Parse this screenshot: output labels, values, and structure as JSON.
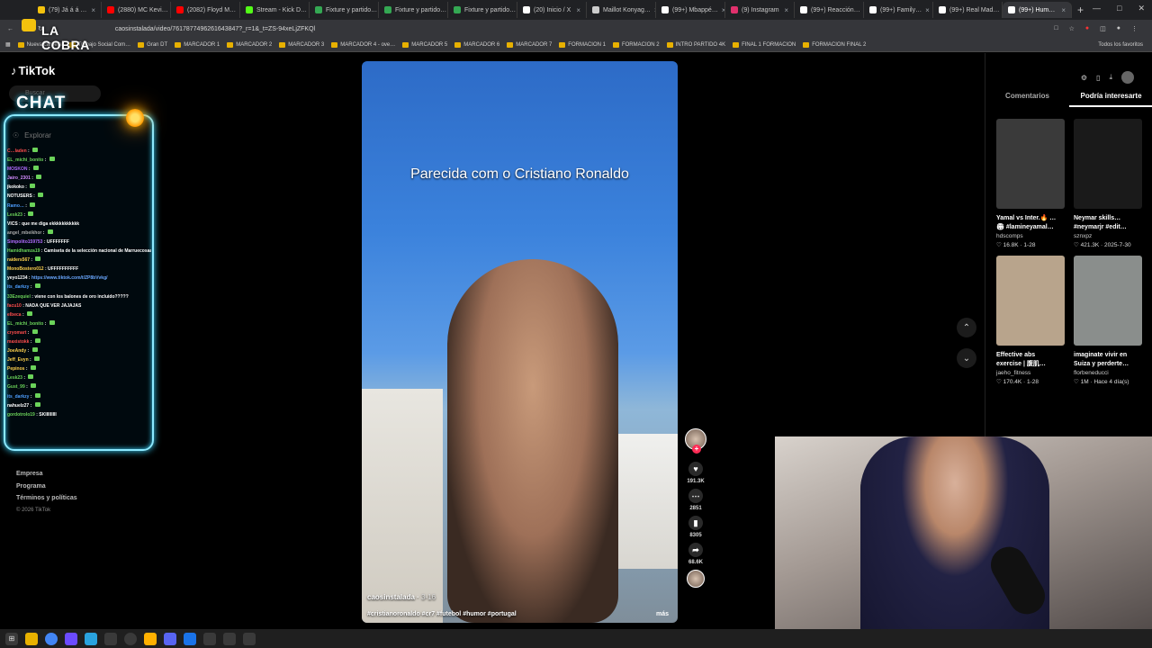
{
  "browser": {
    "tabs": [
      {
        "title": "(79) Já á á …",
        "color": "#f4c20d"
      },
      {
        "title": "(2880) MC Kevi…",
        "color": "#ff0000"
      },
      {
        "title": "(2082) Floyd M…",
        "color": "#ff0000"
      },
      {
        "title": "Stream - Kick D…",
        "color": "#53fc18"
      },
      {
        "title": "Fixture y partido…",
        "color": "#34a853"
      },
      {
        "title": "Fixture y partido…",
        "color": "#34a853"
      },
      {
        "title": "Fixture y partido…",
        "color": "#34a853"
      },
      {
        "title": "(20) Inicio / X",
        "color": "#ffffff"
      },
      {
        "title": "Maillot Konyag…",
        "color": "#cccccc"
      },
      {
        "title": "(99+) Mbappé…",
        "color": "#ffffff"
      },
      {
        "title": "(9) Instagram",
        "color": "#e1306c"
      },
      {
        "title": "(99+) Reacción…",
        "color": "#ffffff"
      },
      {
        "title": "(99+) Family…",
        "color": "#ffffff"
      },
      {
        "title": "(99+) Real Mad…",
        "color": "#ffffff"
      },
      {
        "title": "(99+) Hum…",
        "color": "#ffffff",
        "active": true
      }
    ],
    "url": "caosinstalada/video/7617877496261643847?_r=1&_t=ZS-94xeLjZFKQl",
    "bookmarks": [
      "Nueva carpeta",
      "Trabajo Social Com…",
      "Gran DT",
      "MARCADOR 1",
      "MARCADOR 2",
      "MARCADOR 3",
      "MARCADOR 4 - ove…",
      "MARCADOR 5",
      "MARCADOR 6",
      "MARCADOR 7",
      "FORMACION 1",
      "FORMACION 2",
      "INTRO PARTIDO 4K",
      "FINAL 1 FORMACION",
      "FORMACION FINAL 2"
    ],
    "all_bookmarks": "Todos los favoritos"
  },
  "overlay": {
    "brand": "LA COBRA",
    "chat_label": "CHAT"
  },
  "tiktok": {
    "logo": "TikTok",
    "search_placeholder": "Buscar",
    "explore": "Explorar",
    "footer_links": [
      "Empresa",
      "Programa",
      "Términos y políticas"
    ],
    "copyright": "© 2026 TikTok"
  },
  "chat": [
    {
      "user": "C…laden",
      "color": "#ff4d4d",
      "msg": ""
    },
    {
      "user": "EL_michi_bonito",
      "color": "#6bd35a",
      "msg": ""
    },
    {
      "user": "MOSKON",
      "color": "#b06bff",
      "msg": ""
    },
    {
      "user": "Jairo_2301",
      "color": "#d58cff",
      "msg": ""
    },
    {
      "user": "jkokoko",
      "color": "#ffffff",
      "msg": ""
    },
    {
      "user": "NOTUSERS",
      "color": "#ffffff",
      "msg": ""
    },
    {
      "user": "Ramo…",
      "color": "#4d9fff",
      "msg": ""
    },
    {
      "user": "Lesk23",
      "color": "#6bd35a",
      "msg": ""
    },
    {
      "user": "VICS",
      "color": "#ffffff",
      "msg": "que me diga ekkkkkkkkkkk"
    },
    {
      "user": "angel_mbeikhor",
      "color": "#aaaaaa",
      "msg": ""
    },
    {
      "user": "Simpolito159753",
      "color": "#b06bff",
      "msg": "UFFFFFFF"
    },
    {
      "user": "Hamidhamza19",
      "color": "#6bd35a",
      "msg": "Camiseta de la selección nacional de Marruecosaaaaaaaaaaaaaaaaaaa"
    },
    {
      "user": "raiders567",
      "color": "#ffd24d",
      "msg": ""
    },
    {
      "user": "MonoBostero012",
      "color": "#ffd24d",
      "msg": "UFFFFFFFFFF"
    },
    {
      "user": "yeyo1234",
      "color": "#ffffff",
      "msg": "https://www.tiktok.com/t/ZP8bVvkg/"
    },
    {
      "user": "its_darkzy",
      "color": "#4d9fff",
      "msg": ""
    },
    {
      "user": "33Ezequiel",
      "color": "#6bd35a",
      "msg": "viene con los balones de oro incluido?????"
    },
    {
      "user": "facu10",
      "color": "#ff4d4d",
      "msg": "NADA QUE VER JAJAJAS"
    },
    {
      "user": "elbeca",
      "color": "#ff4d4d",
      "msg": ""
    },
    {
      "user": "EL_michi_bonito",
      "color": "#6bd35a",
      "msg": ""
    },
    {
      "user": "cryomart",
      "color": "#ff4d4d",
      "msg": ""
    },
    {
      "user": "maxistokk",
      "color": "#ff4d4d",
      "msg": ""
    },
    {
      "user": "JoeAndy",
      "color": "#ffd24d",
      "msg": ""
    },
    {
      "user": "Jeff_Evyn",
      "color": "#ffd24d",
      "msg": ""
    },
    {
      "user": "Pepinos",
      "color": "#ffd24d",
      "msg": ""
    },
    {
      "user": "Lesk23",
      "color": "#6bd35a",
      "msg": ""
    },
    {
      "user": "Gust_99",
      "color": "#6bd35a",
      "msg": ""
    },
    {
      "user": "its_darkzy",
      "color": "#4d9fff",
      "msg": ""
    },
    {
      "user": "nahuelz27",
      "color": "#ffffff",
      "msg": ""
    },
    {
      "user": "gordotrolo19",
      "color": "#6bd35a",
      "msg": "SKIIIIIIIII"
    }
  ],
  "video": {
    "caption": "Parecida com o Cristiano Ronaldo",
    "author": "caosinstalada",
    "date": "3-16",
    "tags": "#cristianoronaldo #cr7 #futebol #humor #portugal",
    "more": "más",
    "likes": "191.3K",
    "comments": "2851",
    "saves": "8305",
    "shares": "68.6K"
  },
  "right_panel": {
    "tabs": [
      "Comentarios",
      "Podría interesarte"
    ],
    "active_tab": 1,
    "cards": [
      {
        "title": "Yamal vs Inter.🔥 …",
        "title2": "🏟 #lamineyamal…",
        "author": "hdscomps",
        "likes": "16.8K",
        "date": "1-28",
        "thumb": "#3a3a3a"
      },
      {
        "title": "Neymar skills…",
        "title2": "#neymarjr #edit…",
        "author": "sznxpz",
        "likes": "421.3K",
        "date": "2025-7-30",
        "thumb": "#1a1a1a"
      },
      {
        "title": "Effective abs",
        "title2": "exercise | 腹肌…",
        "author": "jaeho_fitness",
        "likes": "170.4K",
        "date": "1-28",
        "thumb": "#b8a48c"
      },
      {
        "title": "imaginate vivir en",
        "title2": "Suiza y perderte…",
        "author": "florbeneducci",
        "likes": "1M",
        "date": "Hace 4 día(s)",
        "thumb": "#8a8e8c"
      }
    ]
  }
}
